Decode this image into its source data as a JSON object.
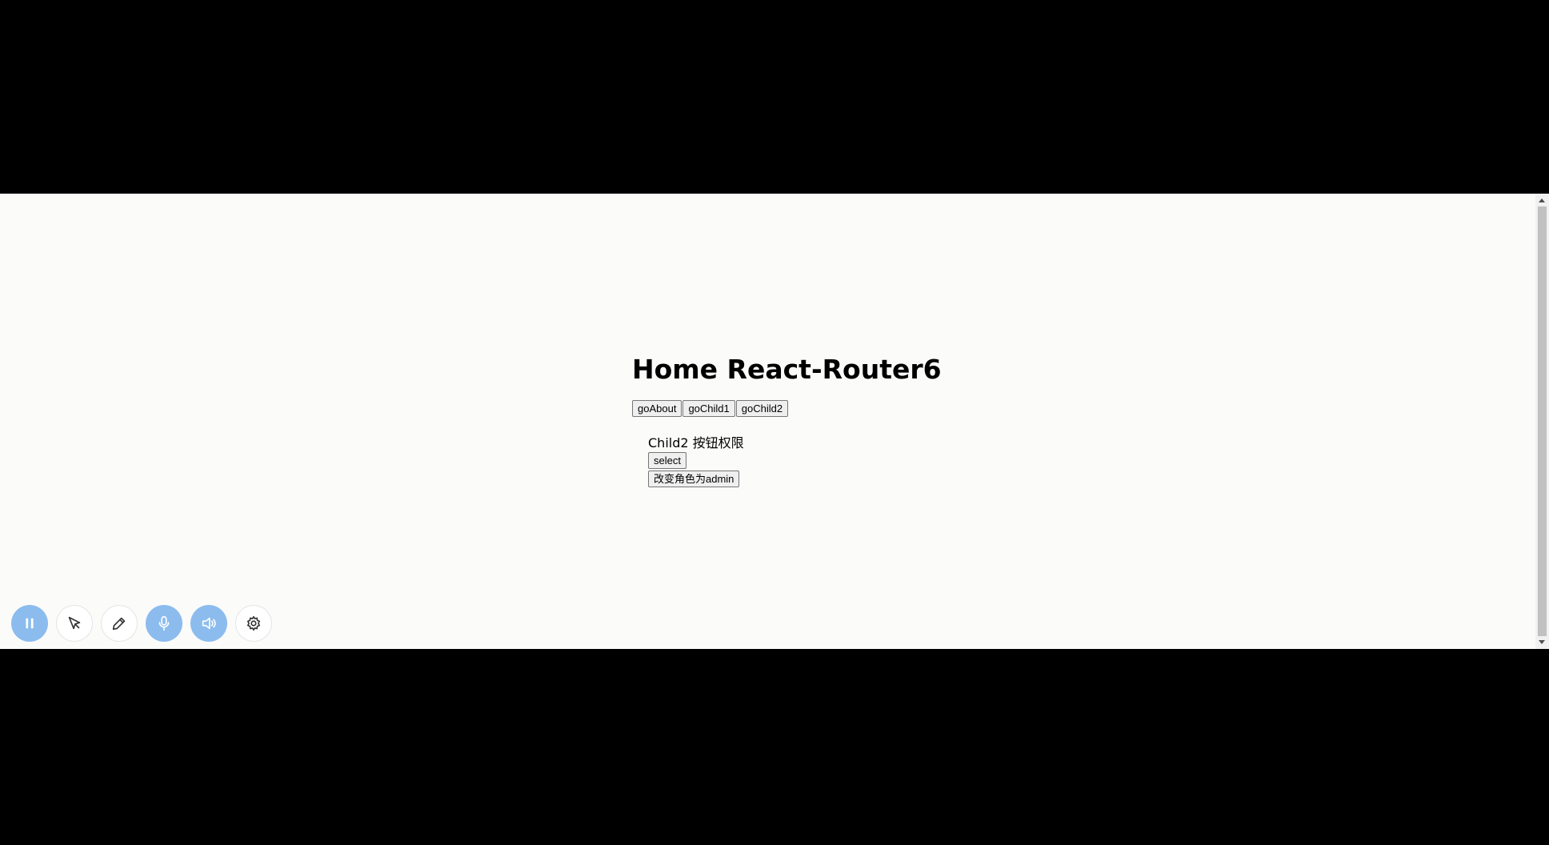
{
  "page": {
    "title": "Home React-Router6"
  },
  "nav": {
    "buttons": [
      "goAbout",
      "goChild1",
      "goChild2"
    ]
  },
  "child": {
    "title": "Child2 按钮权限",
    "select_label": "select",
    "change_role_label": "改变角色为admin"
  },
  "toolbar": {
    "icons": [
      "pause-icon",
      "pointer-icon",
      "pen-icon",
      "microphone-icon",
      "speaker-icon",
      "settings-icon"
    ]
  },
  "colors": {
    "page_background": "#fbfbfa",
    "letterbox": "#000000",
    "toolbar_active": "#8cbcee"
  }
}
